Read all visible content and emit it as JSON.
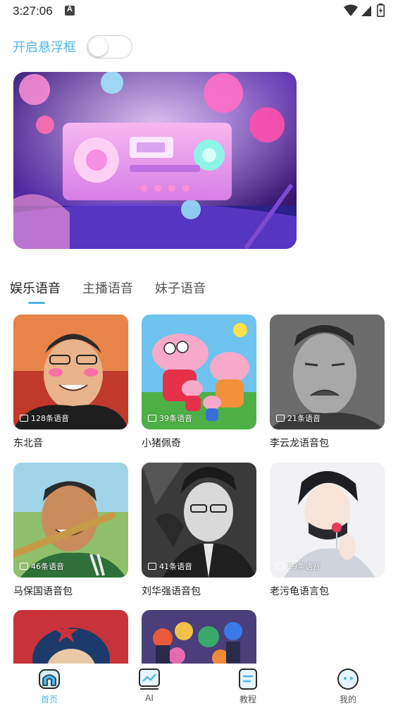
{
  "status_bar": {
    "time": "3:27:06",
    "icons": [
      "notification-a-icon",
      "wifi-icon",
      "cellular-icon",
      "battery-charging-icon"
    ]
  },
  "float_toggle": {
    "label": "开启悬浮框",
    "enabled": false
  },
  "banner": {
    "description_icon": "retro-radio-illustration"
  },
  "tabs": [
    {
      "label": "娱乐语音",
      "active": true
    },
    {
      "label": "主播语音",
      "active": false
    },
    {
      "label": "妹子语音",
      "active": false
    }
  ],
  "cards": [
    {
      "title": "东北音",
      "count": "128条语音"
    },
    {
      "title": "小猪佩奇",
      "count": "39条语音"
    },
    {
      "title": "李云龙语音包",
      "count": "21条语音"
    },
    {
      "title": "马保国语音包",
      "count": "46条语音"
    },
    {
      "title": "刘华强语音包",
      "count": "41条语音"
    },
    {
      "title": "老污龟语言包",
      "count": "19条语音"
    },
    {
      "title": "",
      "count": ""
    },
    {
      "title": "",
      "count": ""
    }
  ],
  "bottom_nav": [
    {
      "label": "首页",
      "icon": "home-icon",
      "active": true
    },
    {
      "label": "AI",
      "icon": "chart-icon",
      "active": false
    },
    {
      "label": "教程",
      "icon": "document-icon",
      "active": false
    },
    {
      "label": "我的",
      "icon": "smiley-icon",
      "active": false
    }
  ],
  "colors": {
    "accent": "#4fb6ea",
    "text": "#222222"
  }
}
